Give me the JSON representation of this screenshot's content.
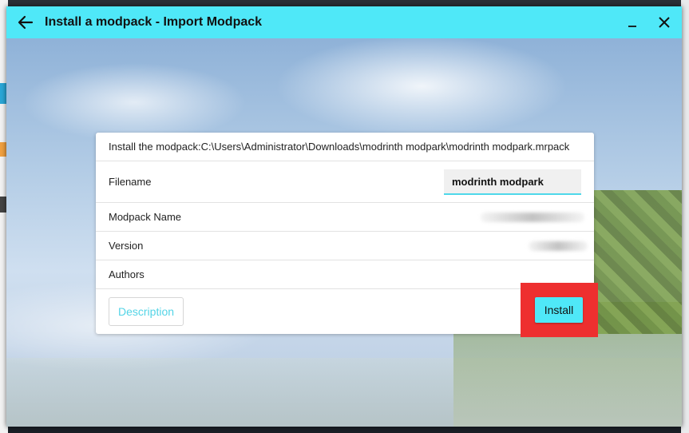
{
  "window": {
    "title": "Install a modpack - Import Modpack",
    "back_icon": "arrow-left-icon",
    "minimize_icon": "minimize-icon",
    "close_icon": "close-icon"
  },
  "card": {
    "path_label": "Install the modpack:C:\\Users\\Administrator\\Downloads\\modrinth modpark\\modrinth modpark.mrpack",
    "filename_label": "Filename",
    "filename_value": "modrinth modpark",
    "modpack_name_label": "Modpack Name",
    "version_label": "Version",
    "authors_label": "Authors",
    "description_button": "Description",
    "install_button": "Install"
  },
  "colors": {
    "accent": "#4fe8f8",
    "highlight": "#ee2f2f"
  }
}
